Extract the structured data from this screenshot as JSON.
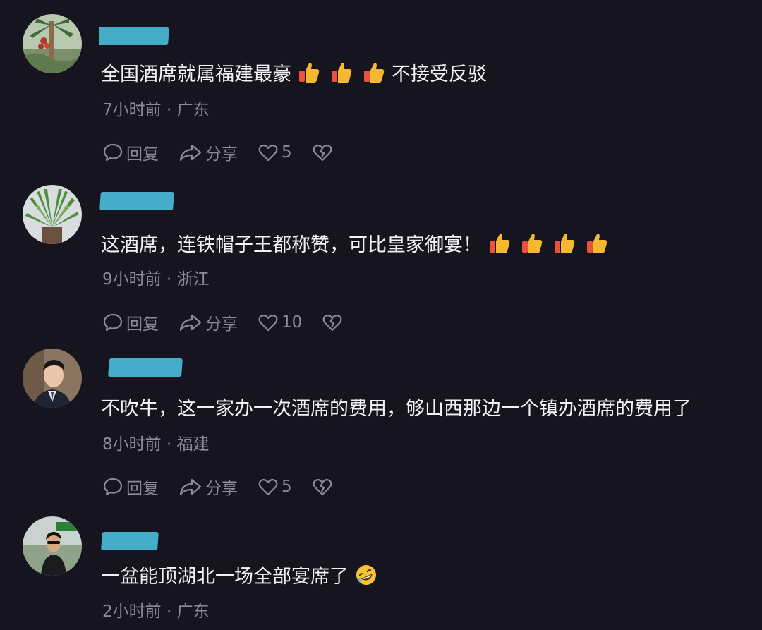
{
  "comments": [
    {
      "username_fragment": "",
      "text": "全国酒席就属福建最豪",
      "emoji": [
        "thumbs-up",
        "thumbs-up",
        "thumbs-up"
      ],
      "text_after": "不接受反驳",
      "time": "7小时前",
      "location": "广东",
      "reply_label": "回复",
      "share_label": "分享",
      "likes": "5"
    },
    {
      "username_fragment": "",
      "text": "这酒席，连铁帽子王都称赞，可比皇家御宴！",
      "emoji": [
        "thumbs-up",
        "thumbs-up",
        "thumbs-up",
        "thumbs-up"
      ],
      "text_after": "",
      "time": "9小时前",
      "location": "浙江",
      "reply_label": "回复",
      "share_label": "分享",
      "likes": "10"
    },
    {
      "username_fragment": "",
      "text": "不吹牛，这一家办一次酒席的费用，够山西那边一个镇办酒席的费用了",
      "emoji": [],
      "text_after": "",
      "time": "8小时前",
      "location": "福建",
      "reply_label": "回复",
      "share_label": "分享",
      "likes": "5"
    },
    {
      "username_fragment": "",
      "text": "一盆能顶湖北一场全部宴席了",
      "emoji": [
        "rolling-on-floor-laughing"
      ],
      "text_after": "",
      "time": "2小时前",
      "location": "广东"
    }
  ],
  "meta_separator": "·",
  "colors": {
    "background": "#15141f",
    "text": "#f3f3f6",
    "secondary": "#8c8b97",
    "redaction": "#4fc8e8"
  }
}
